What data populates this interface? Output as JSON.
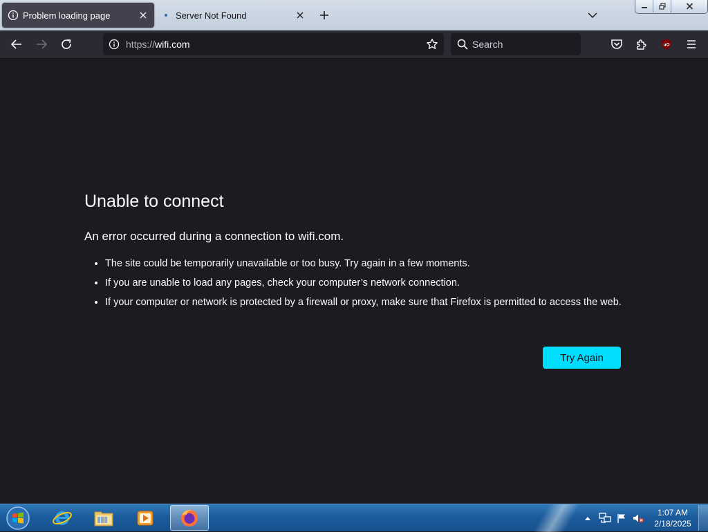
{
  "browser": {
    "tabs": [
      {
        "label": "Problem loading page",
        "active": true
      },
      {
        "label": "Server Not Found",
        "active": false
      }
    ],
    "url_prefix": "https://",
    "url_host": "wifi.com",
    "search_placeholder": "Search"
  },
  "page": {
    "title": "Unable to connect",
    "lead": "An error occurred during a connection to wifi.com.",
    "bullets": [
      "The site could be temporarily unavailable or too busy. Try again in a few moments.",
      "If you are unable to load any pages, check your computer’s network connection.",
      "If your computer or network is protected by a firewall or proxy, make sure that Firefox is permitted to access the web."
    ],
    "try_again_label": "Try Again"
  },
  "taskbar": {
    "time": "1:07 AM",
    "date": "2/18/2025",
    "apps": [
      "internet-explorer",
      "file-explorer",
      "media-player",
      "firefox"
    ]
  },
  "colors": {
    "page_bg": "#1c1b22",
    "toolbar_bg": "#2b2a33",
    "accent_button": "#00ddff",
    "ublock_badge": "#800000"
  }
}
